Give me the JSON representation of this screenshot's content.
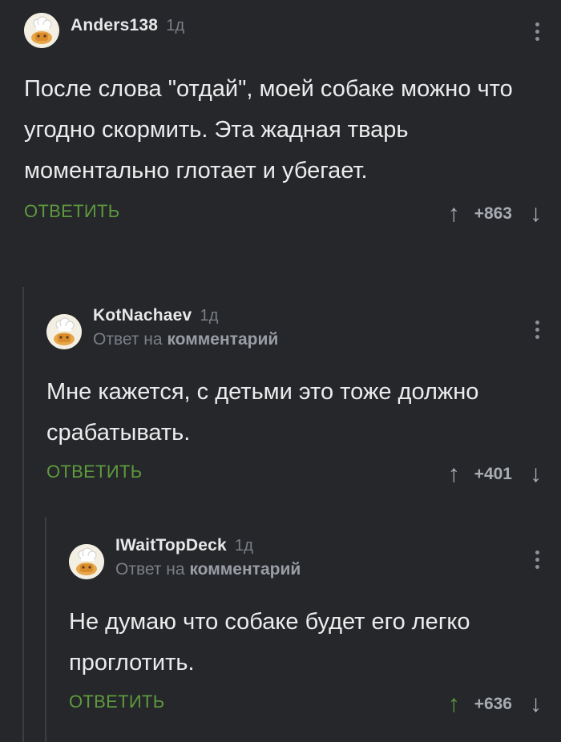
{
  "comments": [
    {
      "username": "Anders138",
      "time": "1д",
      "reply_prefix": "",
      "reply_target": "",
      "text": "После слова \"отдай\", моей собаке можно что угодно скормить. Эта жадная тварь моментально глотает и убегает.",
      "reply_label": "ОТВЕТИТЬ",
      "score": "+863",
      "upvoted": false
    },
    {
      "username": "KotNachaev",
      "time": "1д",
      "reply_prefix": "Ответ на",
      "reply_target": "комментарий",
      "text": "Мне кажется, с детьми это тоже должно срабатывать.",
      "reply_label": "ОТВЕТИТЬ",
      "score": "+401",
      "upvoted": false
    },
    {
      "username": "IWaitTopDeck",
      "time": "1д",
      "reply_prefix": "Ответ на",
      "reply_target": "комментарий",
      "text": "Не думаю что собаке будет его легко проглотить.",
      "reply_label": "ОТВЕТИТЬ",
      "score": "+636",
      "upvoted": true
    }
  ],
  "icons": {
    "upvote": "arrow-up-icon",
    "downvote": "arrow-down-icon",
    "more": "vertical-dots-icon",
    "avatar": "chef-bun-avatar"
  },
  "colors": {
    "background": "#25272b",
    "accent_green": "#5f9a3d",
    "muted": "#7b7f86",
    "thread_line": "#3a3d42"
  }
}
